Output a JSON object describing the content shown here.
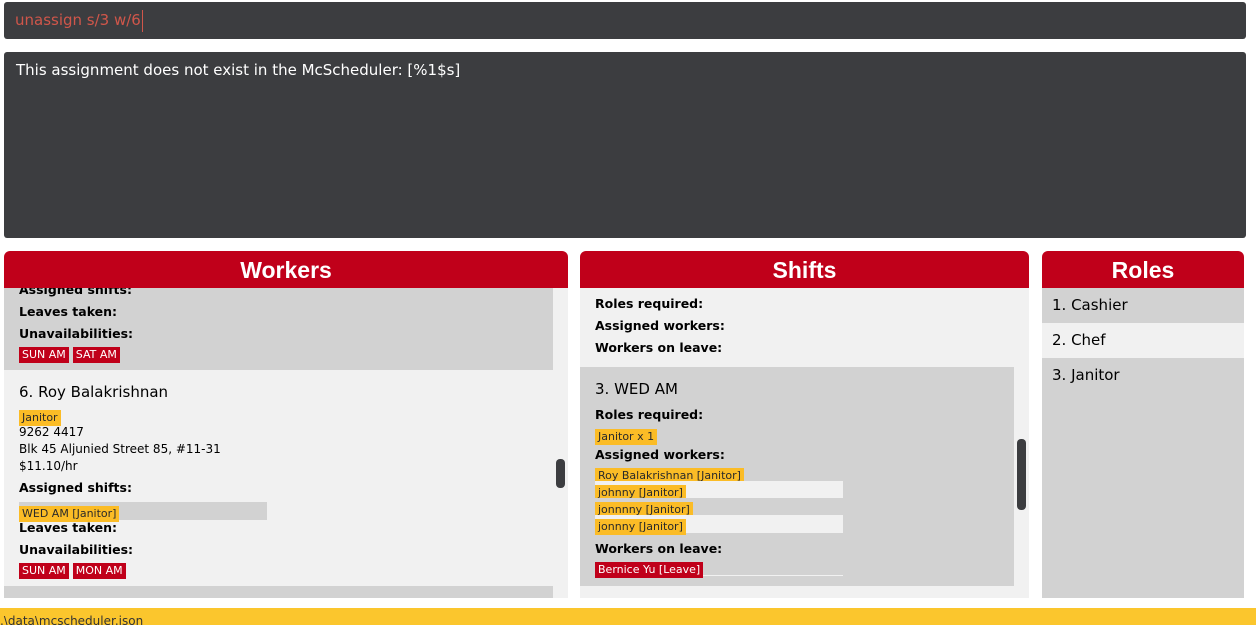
{
  "command": {
    "value": "unassign s/3 w/6"
  },
  "result": {
    "message": "This assignment does not exist in the McScheduler: [%1$s]"
  },
  "workers": {
    "title": "Workers",
    "labels": {
      "assigned_shifts": "Assigned shifts:",
      "leaves_taken": "Leaves taken:",
      "unavailabilities": "Unavailabilities:"
    },
    "card_prev": {
      "unavailabilities": [
        "SUN AM",
        "SAT AM"
      ]
    },
    "card_current": {
      "index_name": "6.  Roy Balakrishnan",
      "role": "Janitor",
      "phone": "9262 4417",
      "address": "Blk 45 Aljunied Street 85, #11-31",
      "pay": "$11.10/hr",
      "assigned_shifts": [
        "WED AM [Janitor]"
      ],
      "unavailabilities": [
        "SUN AM",
        "MON AM"
      ]
    }
  },
  "shifts": {
    "title": "Shifts",
    "labels": {
      "roles_required": "Roles required:",
      "assigned_workers": "Assigned workers:",
      "workers_on_leave": "Workers on leave:"
    },
    "card_current": {
      "index_name": "3.  WED AM",
      "roles_required": [
        "Janitor x 1"
      ],
      "assigned_workers": [
        "Roy Balakrishnan [Janitor]",
        "johnny [Janitor]",
        "jonnnny [Janitor]",
        "jonnny [Janitor]"
      ],
      "workers_on_leave": [
        "Bernice Yu [Leave]"
      ]
    }
  },
  "roles": {
    "title": "Roles",
    "items": [
      "1.  Cashier",
      "2.  Chef",
      "3.  Janitor"
    ]
  },
  "status_bar": {
    "path": ".\\data\\mcscheduler.json"
  }
}
